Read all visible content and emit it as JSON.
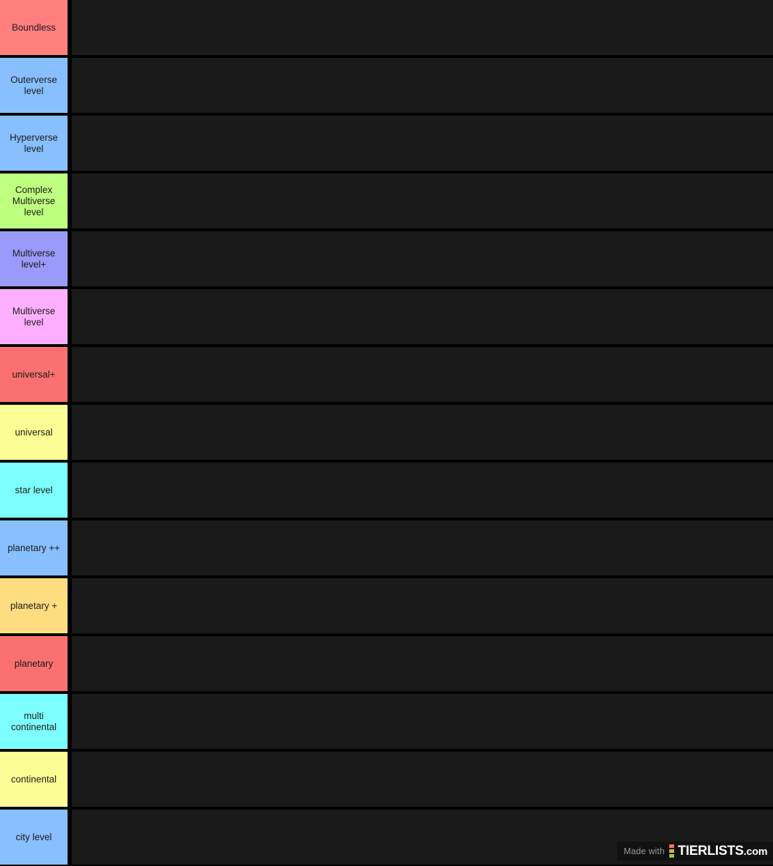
{
  "app": {
    "type": "tier-list",
    "background_color": "#000000",
    "row_background_color": "#1a1a1a",
    "label_text_color": "#1c1c1c"
  },
  "tiers": [
    {
      "label": "Boundless",
      "color": "#FF7F7F",
      "items": []
    },
    {
      "label": "Outerverse level",
      "color": "#87BFFF",
      "items": []
    },
    {
      "label": "Hyperverse level",
      "color": "#87BFFF",
      "items": []
    },
    {
      "label": "Complex Multiverse level",
      "color": "#BEFF80",
      "items": []
    },
    {
      "label": "Multiverse level+",
      "color": "#9A9AFB",
      "items": []
    },
    {
      "label": "Multiverse level",
      "color": "#FFAFFF",
      "items": []
    },
    {
      "label": "universal+",
      "color": "#FA7070",
      "items": []
    },
    {
      "label": "universal",
      "color": "#FDFD96",
      "items": []
    },
    {
      "label": "star level",
      "color": "#7DFFFF",
      "items": []
    },
    {
      "label": "planetary ++",
      "color": "#87BFFF",
      "items": []
    },
    {
      "label": "planetary +",
      "color": "#FDDD80",
      "items": []
    },
    {
      "label": "planetary",
      "color": "#FA7070",
      "items": []
    },
    {
      "label": "multi continental",
      "color": "#7DFFFF",
      "items": []
    },
    {
      "label": "continental",
      "color": "#FDFD96",
      "items": []
    },
    {
      "label": "city level",
      "color": "#87BFFF",
      "items": []
    }
  ],
  "watermark": {
    "made_with_label": "Made with",
    "brand_name": "TIERLISTS",
    "brand_tld": ".com",
    "dot_colors": [
      "#F4756B",
      "#F0A830",
      "#9ACD32"
    ]
  }
}
